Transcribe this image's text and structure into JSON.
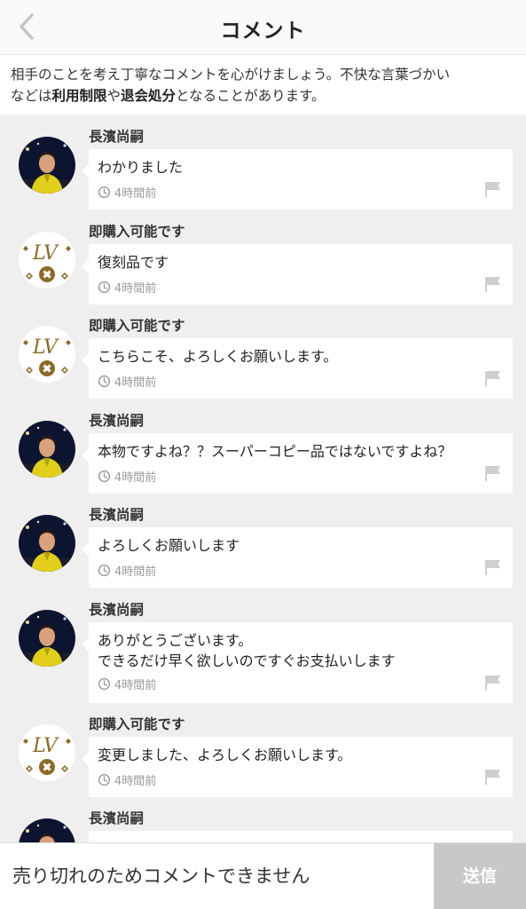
{
  "header": {
    "title": "コメント"
  },
  "notice": {
    "text_1": "相手のことを考え丁寧なコメントを心がけましょう。不快な言葉づかい",
    "text_2": "などは",
    "bold_1": "利用制限",
    "text_3": "や",
    "bold_2": "退会処分",
    "text_4": "となることがあります。"
  },
  "comments": [
    {
      "author": "長濱尚嗣",
      "avatar": "person-photo",
      "text": "わかりました",
      "time": "4時間前"
    },
    {
      "author": "即購入可能です",
      "avatar": "lv-logo",
      "text": "復刻品です",
      "time": "4時間前"
    },
    {
      "author": "即購入可能です",
      "avatar": "lv-logo",
      "text": "こちらこそ、よろしくお願いします。",
      "time": "4時間前"
    },
    {
      "author": "長濱尚嗣",
      "avatar": "person-photo",
      "text": "本物ですよね？？スーパーコピー品ではないですよね？",
      "time": "4時間前"
    },
    {
      "author": "長濱尚嗣",
      "avatar": "person-photo",
      "text": "よろしくお願いします",
      "time": "4時間前"
    },
    {
      "author": "長濱尚嗣",
      "avatar": "person-photo",
      "text": "ありがとうございます。\nできるだけ早く欲しいのですぐお支払いします",
      "time": "4時間前"
    },
    {
      "author": "即購入可能です",
      "avatar": "lv-logo",
      "text": "変更しました、よろしくお願いします。",
      "time": "4時間前"
    },
    {
      "author": "長濱尚嗣",
      "avatar": "person-photo",
      "text": "",
      "time": ""
    }
  ],
  "footer": {
    "input_text": "売り切れのためコメントできません",
    "send_label": "送信"
  },
  "colors": {
    "list_background": "#efefef",
    "send_disabled": "#c8c8c8",
    "muted_text": "#999999",
    "lv_gold": "#8a6a2a"
  }
}
